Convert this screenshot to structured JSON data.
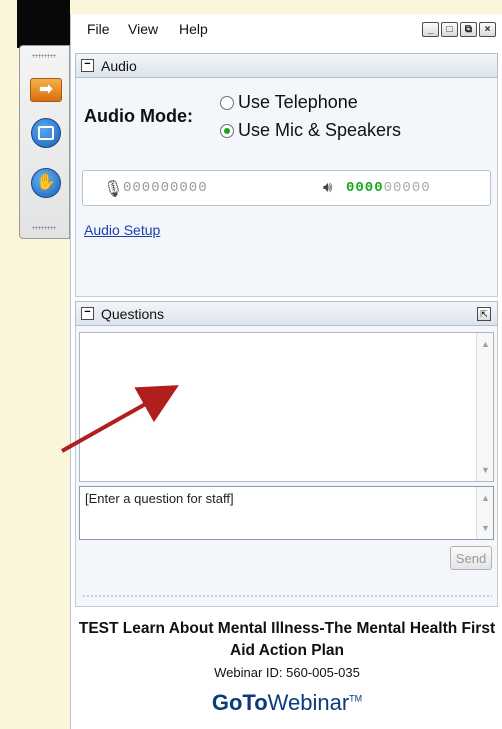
{
  "menu": [
    "File",
    "View",
    "Help"
  ],
  "window_buttons": [
    "_",
    "□",
    "⧉",
    "×"
  ],
  "audio": {
    "section_title": "Audio",
    "mode_label": "Audio Mode:",
    "option_telephone": "Use Telephone",
    "option_mic": "Use Mic & Speakers",
    "selected": "Use Mic & Speakers",
    "mic_meter": "000000000",
    "speaker_meter_on": "0000",
    "speaker_meter_off": "00000",
    "setup_link": "Audio Setup"
  },
  "questions": {
    "section_title": "Questions",
    "input_text": "[Enter a question for staff]",
    "send_label": "Send"
  },
  "webinar": {
    "title": "TEST Learn About Mental Illness-The Mental Health First Aid Action Plan",
    "id_text": "Webinar ID: 560-005-035",
    "brand_go": "Go",
    "brand_to": "To",
    "brand_webinar": "Webinar",
    "brand_tm": "TM"
  },
  "colors": {
    "accent": "#1ea01e",
    "link": "#1a3fb0",
    "arrow": "#b01e1e",
    "brand": "#0d3a7a"
  },
  "icons": [
    "arrow-icon",
    "screen-icon",
    "raise-hand-icon",
    "microphone-icon",
    "speaker-icon",
    "popout-icon"
  ]
}
